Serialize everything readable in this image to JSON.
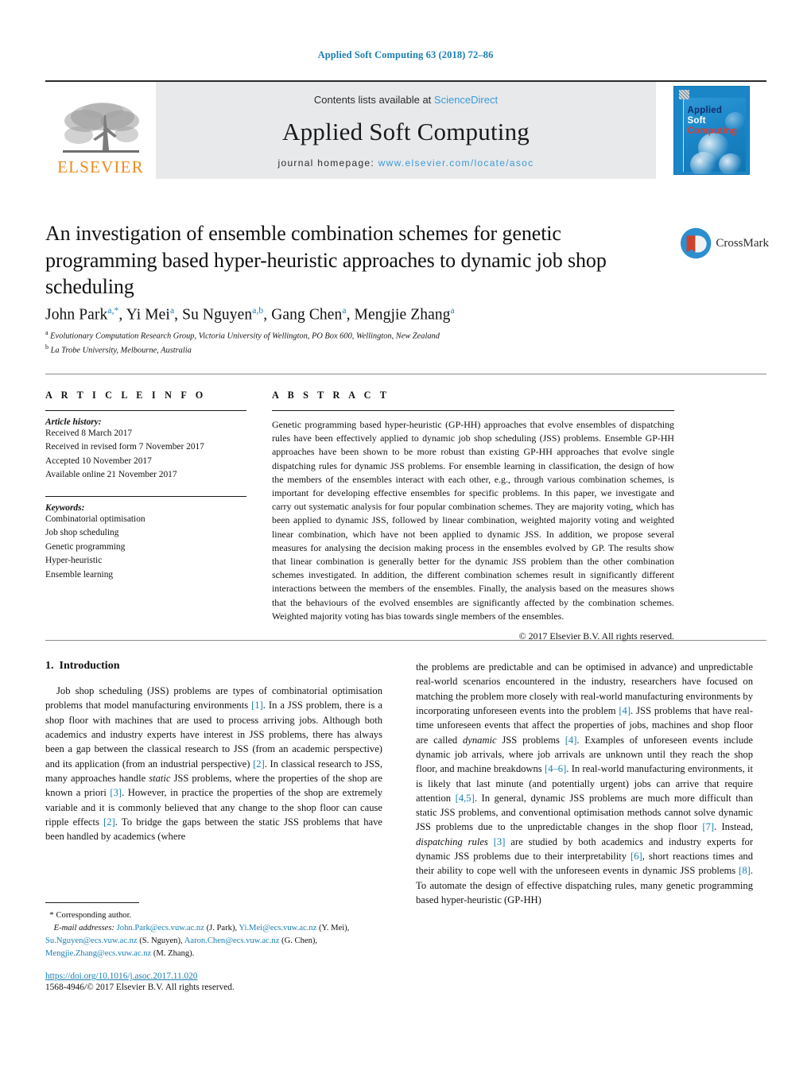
{
  "running_head": "Applied Soft Computing 63 (2018) 72–86",
  "masthead": {
    "publisher_name": "ELSEVIER",
    "contents_prefix": "Contents lists available at ",
    "contents_link": "ScienceDirect",
    "journal_name": "Applied Soft Computing",
    "homepage_prefix": "journal homepage: ",
    "homepage_url": "www.elsevier.com/locate/asoc",
    "cover": {
      "line1": "Applied",
      "line2": "Soft",
      "line3": "Computing"
    }
  },
  "article": {
    "title": "An investigation of ensemble combination schemes for genetic programming based hyper-heuristic approaches to dynamic job shop scheduling",
    "crossmark_label": "CrossMark",
    "authors_html": "John Park<sup>a,<span class=\"star\">*</span></sup>, Yi Mei<sup>a</sup>, Su Nguyen<sup>a,b</sup>, Gang Chen<sup>a</sup>, Mengjie Zhang<sup>a</sup>",
    "affiliations": [
      {
        "marker": "a",
        "text": "Evolutionary Computation Research Group, Victoria University of Wellington, PO Box 600, Wellington, New Zealand"
      },
      {
        "marker": "b",
        "text": "La Trobe University, Melbourne, Australia"
      }
    ]
  },
  "article_info": {
    "heading": "A R T I C L E  I N F O",
    "history_label": "Article history:",
    "history": [
      "Received 8 March 2017",
      "Received in revised form 7 November 2017",
      "Accepted 10 November 2017",
      "Available online 21 November 2017"
    ],
    "keywords_label": "Keywords:",
    "keywords": [
      "Combinatorial optimisation",
      "Job shop scheduling",
      "Genetic programming",
      "Hyper-heuristic",
      "Ensemble learning"
    ]
  },
  "abstract": {
    "heading": "A B S T R A C T",
    "text": "Genetic programming based hyper-heuristic (GP-HH) approaches that evolve ensembles of dispatching rules have been effectively applied to dynamic job shop scheduling (JSS) problems. Ensemble GP-HH approaches have been shown to be more robust than existing GP-HH approaches that evolve single dispatching rules for dynamic JSS problems. For ensemble learning in classification, the design of how the members of the ensembles interact with each other, e.g., through various combination schemes, is important for developing effective ensembles for specific problems. In this paper, we investigate and carry out systematic analysis for four popular combination schemes. They are majority voting, which has been applied to dynamic JSS, followed by linear combination, weighted majority voting and weighted linear combination, which have not been applied to dynamic JSS. In addition, we propose several measures for analysing the decision making process in the ensembles evolved by GP. The results show that linear combination is generally better for the dynamic JSS problem than the other combination schemes investigated. In addition, the different combination schemes result in significantly different interactions between the members of the ensembles. Finally, the analysis based on the measures shows that the behaviours of the evolved ensembles are significantly affected by the combination schemes. Weighted majority voting has bias towards single members of the ensembles.",
    "copyright": "© 2017 Elsevier B.V. All rights reserved."
  },
  "introduction": {
    "section_number": "1.",
    "section_title": "Introduction",
    "left_paragraph_html": "Job shop scheduling (JSS) problems are types of combinatorial optimisation problems that model manufacturing environments <span class=\"ref\">[1]</span>. In a JSS problem, there is a shop floor with machines that are used to process arriving jobs. Although both academics and industry experts have interest in JSS problems, there has always been a gap between the classical research to JSS (from an academic perspective) and its application (from an industrial perspective) <span class=\"ref\">[2]</span>. In classical research to JSS, many approaches handle <em class=\"it\">static</em> JSS problems, where the properties of the shop are known a priori <span class=\"ref\">[3]</span>. However, in practice the properties of the shop are extremely variable and it is commonly believed that any change to the shop floor can cause ripple effects <span class=\"ref\">[2]</span>. To bridge the gaps between the static JSS problems that have been handled by academics (where",
    "right_paragraph_html": "the problems are predictable and can be optimised in advance) and unpredictable real-world scenarios encountered in the industry, researchers have focused on matching the problem more closely with real-world manufacturing environments by incorporating unforeseen events into the problem <span class=\"ref\">[4]</span>. JSS problems that have real-time unforeseen events that affect the properties of jobs, machines and shop floor are called <em class=\"it\">dynamic</em> JSS problems <span class=\"ref\">[4]</span>. Examples of unforeseen events include dynamic job arrivals, where job arrivals are unknown until they reach the shop floor, and machine breakdowns <span class=\"ref\">[4–6]</span>. In real-world manufacturing environments, it is likely that last minute (and potentially urgent) jobs can arrive that require attention <span class=\"ref\">[4,5]</span>. In general, dynamic JSS problems are much more difficult than static JSS problems, and conventional optimisation methods cannot solve dynamic JSS problems due to the unpredictable changes in the shop floor <span class=\"ref\">[7]</span>. Instead, <em class=\"it\">dispatching rules</em> <span class=\"ref\">[3]</span> are studied by both academics and industry experts for dynamic JSS problems due to their interpretability <span class=\"ref\">[6]</span>, short reactions times and their ability to cope well with the unforeseen events in dynamic JSS problems <span class=\"ref\">[8]</span>. To automate the design of effective dispatching rules, many genetic programming based hyper-heuristic (GP-HH)"
  },
  "footnotes": {
    "corresponding_marker": "*",
    "corresponding_text": "Corresponding author.",
    "email_label": "E-mail addresses:",
    "emails_html": "<span class=\"mail\">John.Park@ecs.vuw.ac.nz</span> (J. Park), <span class=\"mail\">Yi.Mei@ecs.vuw.ac.nz</span> (Y. Mei), <span class=\"mail\">Su.Nguyen@ecs.vuw.ac.nz</span> (S. Nguyen), <span class=\"mail\">Aaron.Chen@ecs.vuw.ac.nz</span> (G. Chen), <span class=\"mail\">Mengjie.Zhang@ecs.vuw.ac.nz</span> (M. Zhang).",
    "doi": "https://doi.org/10.1016/j.asoc.2017.11.020",
    "issn_line": "1568-4946/© 2017 Elsevier B.V. All rights reserved."
  },
  "colors": {
    "link": "#1a7fb3",
    "science_direct": "#3a9ad9",
    "elsevier_orange": "#f08a1d",
    "band_gray": "#e8e9eb",
    "cover_blue": "#1a86c8"
  }
}
